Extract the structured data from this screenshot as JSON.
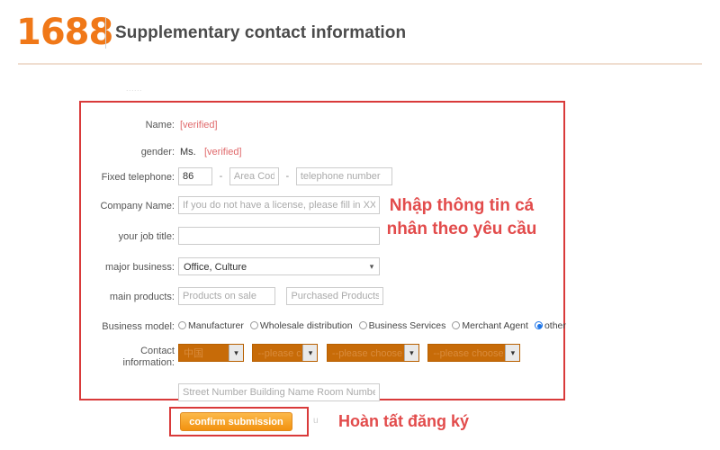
{
  "header": {
    "logo": "1688",
    "title": "Supplementary contact information"
  },
  "ghost": {
    "top_fragment": "......",
    "after_button": "u"
  },
  "form": {
    "name": {
      "label": "Name:",
      "value": "[verified]"
    },
    "gender": {
      "label": "gender:",
      "value": "Ms.",
      "verified": "[verified]"
    },
    "fixed_telephone": {
      "label": "Fixed telephone:",
      "country_code": "86",
      "separator": "-",
      "area_code_placeholder": "Area Code",
      "number_placeholder": "telephone number"
    },
    "company_name": {
      "label": "Company Name:",
      "placeholder": "If you do not have a license, please fill in XXX (i"
    },
    "job_title": {
      "label": "your job title:",
      "value": ""
    },
    "major_business": {
      "label": "major business:",
      "selected": "Office, Culture",
      "caret": "chevron-down"
    },
    "main_products": {
      "label": "main products:",
      "on_sale_placeholder": "Products on sale",
      "purchased_placeholder": "Purchased Products"
    },
    "business_model": {
      "label": "Business model:",
      "options": [
        {
          "label": "Manufacturer",
          "selected": false
        },
        {
          "label": "Wholesale distribution",
          "selected": false
        },
        {
          "label": "Business Services",
          "selected": false
        },
        {
          "label": "Merchant Agent",
          "selected": false
        },
        {
          "label": "other",
          "selected": true
        }
      ]
    },
    "contact_information": {
      "label_line1": "Contact",
      "label_line2": "information:",
      "selects": [
        {
          "value": "中国",
          "highlighted": true
        },
        {
          "value": "--please choose--",
          "highlighted": true
        },
        {
          "value": "--please choose--",
          "highlighted": true
        },
        {
          "value": "--please choose--",
          "highlighted": true
        }
      ]
    },
    "street_address": {
      "placeholder": "Street Number Building Name Room Number"
    }
  },
  "actions": {
    "submit_label": "confirm submission"
  },
  "annotations": {
    "main_note": "Nhập thông tin cá nhân theo yêu cầu",
    "submit_note": "Hoàn tất đăng ký"
  },
  "colors": {
    "brand_orange": "#F07818",
    "annotation_red": "#e24b4b",
    "box_red": "#d93a3a",
    "highlight_orange": "#c76b08",
    "radio_blue": "#1a73e8"
  }
}
